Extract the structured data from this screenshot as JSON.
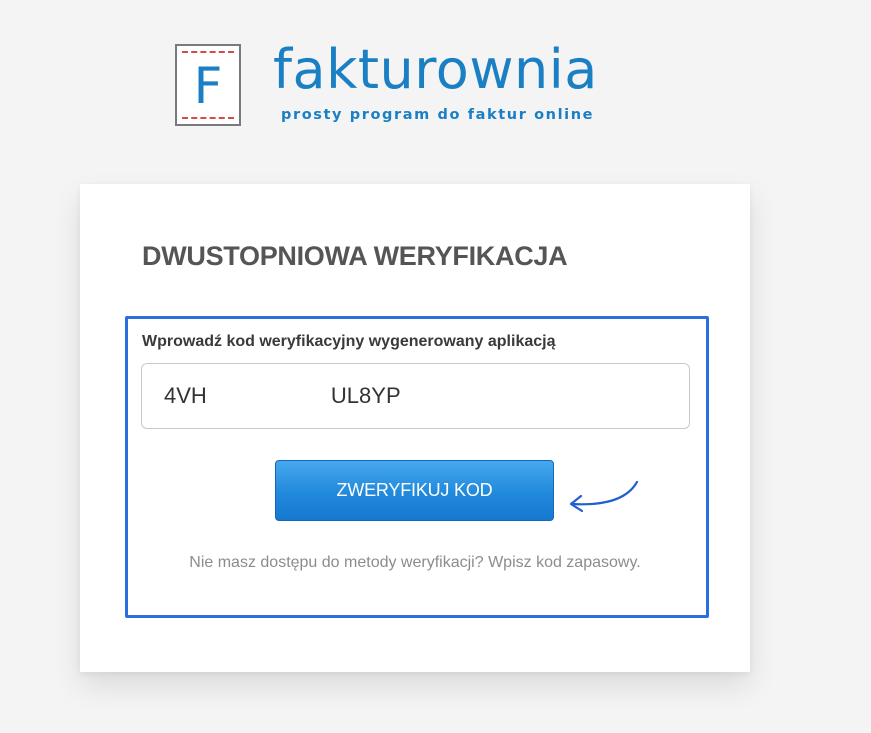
{
  "logo": {
    "letter": "F",
    "name": "fakturownia",
    "tagline": "prosty program do faktur online"
  },
  "card": {
    "title": "DWUSTOPNIOWA WERYFIKACJA",
    "code_label": "Wprowadź kod weryfikacyjny wygenerowany aplikacją",
    "code_value": "4VH UL8YP",
    "verify_button_label": "ZWERYFIKUJ KOD",
    "backup_link_text": "Nie masz dostępu do metody weryfikacji? Wpisz kod zapasowy."
  },
  "icons": {
    "annotation_arrow": "curved-arrow-icon"
  },
  "colors": {
    "brand_blue": "#1a7fc3",
    "highlight_border": "#2a6fe0",
    "button_top": "#47a8ee",
    "button_bottom": "#1678cf",
    "logo_dash_red": "#d84c3e"
  }
}
